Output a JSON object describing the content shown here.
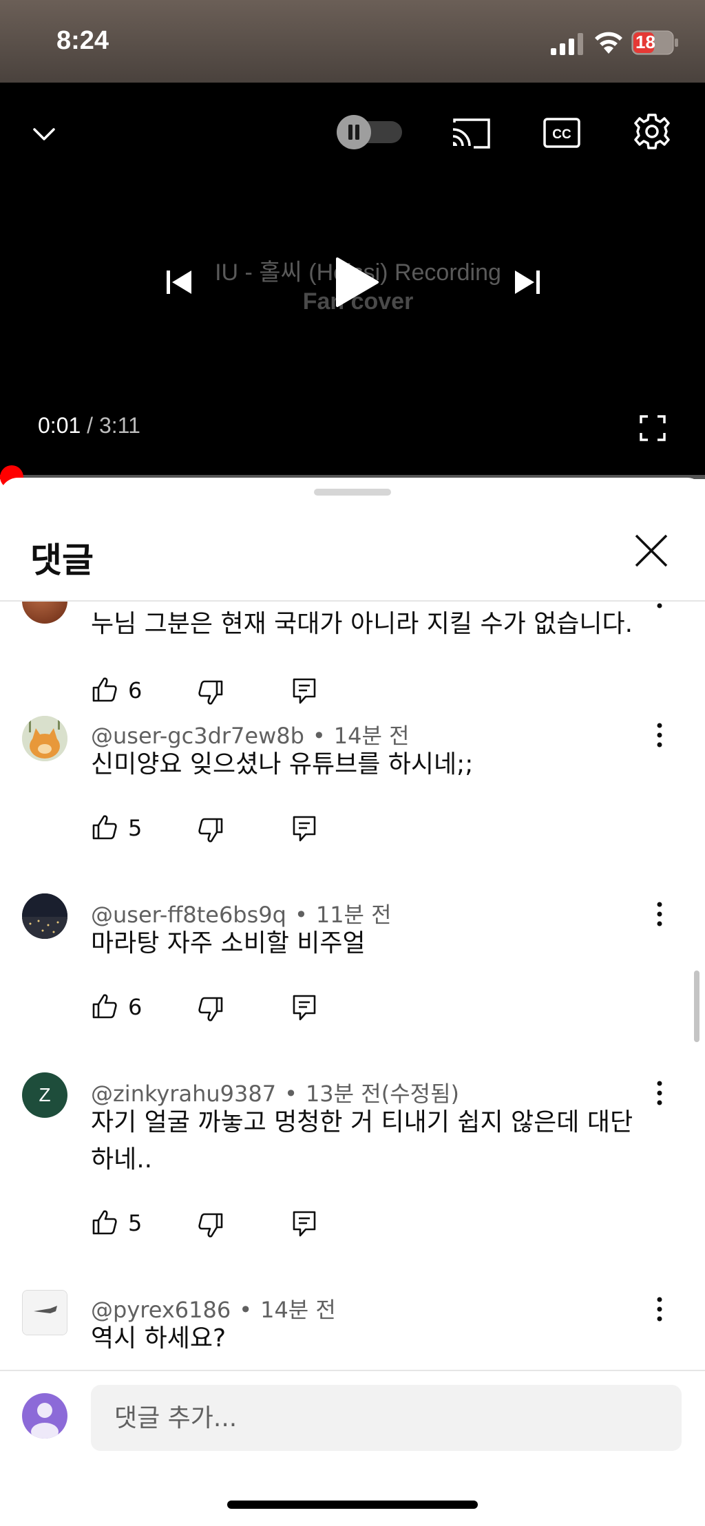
{
  "status_bar": {
    "time": "8:24",
    "battery": "18"
  },
  "player": {
    "title_line1": "IU - 홀씨 (Holssi) Recording",
    "title_line2": "Fan cover",
    "time_current": "0:01",
    "time_separator": " / ",
    "time_total": "3:11",
    "progress_fraction": 0.005
  },
  "comments_panel": {
    "title": "댓글",
    "add_comment_placeholder": "댓글 추가...",
    "comments": [
      {
        "author": "",
        "time": "",
        "text": "누님 그분은 현재 국대가 아니라 지킬 수가 없습니다.",
        "likes": "6"
      },
      {
        "author": "@user-gc3dr7ew8b",
        "time": "14분 전",
        "text": "신미양요 잊으셨나 유튜브를 하시네;;",
        "likes": "5"
      },
      {
        "author": "@user-ff8te6bs9q",
        "time": "11분 전",
        "text": "마라탕 자주 소비할 비주얼",
        "likes": "6"
      },
      {
        "author": "@zinkyrahu9387",
        "time": "13분 전(수정됨)",
        "text": "자기 얼굴 까놓고 멍청한 거 티내기 쉽지 않은데 대단하네..",
        "likes": "5",
        "avatar_letter": "Z"
      },
      {
        "author": "@pyrex6186",
        "time": "14분 전",
        "text": "역시 하세요?",
        "likes": ""
      }
    ]
  },
  "colors": {
    "accent": "#ff0000",
    "avatar_z": "#1e4d3b",
    "my_avatar": "#8c6ad8"
  }
}
